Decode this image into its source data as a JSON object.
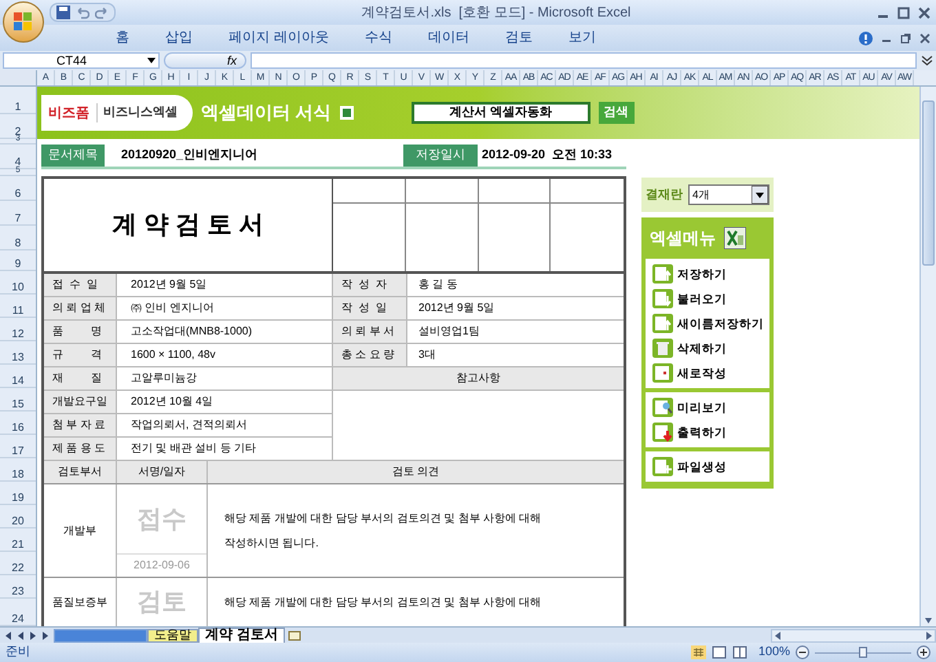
{
  "window": {
    "title": "계약검토서.xls  [호환 모드] - Microsoft Excel"
  },
  "ribbon_tabs": [
    "홈",
    "삽입",
    "페이지 레이아웃",
    "수식",
    "데이터",
    "검토",
    "보기"
  ],
  "formula_bar": {
    "name_box": "CT44",
    "function_label": "fx"
  },
  "column_headers": [
    "A",
    "B",
    "C",
    "D",
    "E",
    "F",
    "G",
    "H",
    "I",
    "J",
    "K",
    "L",
    "M",
    "N",
    "O",
    "P",
    "Q",
    "R",
    "S",
    "T",
    "U",
    "V",
    "W",
    "X",
    "Y",
    "Z",
    "AA",
    "AB",
    "AC",
    "AD",
    "AE",
    "AF",
    "AG",
    "AH",
    "AI",
    "AJ",
    "AK",
    "AL",
    "AM",
    "AN",
    "AO",
    "AP",
    "AQ",
    "AR",
    "AS",
    "AT",
    "AU",
    "AV",
    "AW"
  ],
  "row_headers": [
    "1",
    "2",
    "3",
    "4",
    "5",
    "6",
    "7",
    "8",
    "9",
    "10",
    "11",
    "12",
    "13",
    "14",
    "15",
    "16",
    "17",
    "18",
    "19",
    "20",
    "21",
    "22",
    "23",
    "24"
  ],
  "banner": {
    "brand": "비즈폼",
    "sub_brand": "비즈니스엑셀",
    "title": "엑셀데이터 서식",
    "search_value": "계산서 엑셀자동화",
    "search_button": "검색"
  },
  "document": {
    "title_label": "문서제목",
    "title_value": "20120920_인비엔지니어",
    "saved_label": "저장일시",
    "saved_value": "2012-09-20  오전 10:33"
  },
  "form": {
    "title": "계 약 검 토 서",
    "info_rows": [
      {
        "label": "접  수  일",
        "value": "2012년 9월 5일",
        "right_label": "작  성  자",
        "right_value": "홍 길 동"
      },
      {
        "label": "의 뢰 업 체",
        "value": "㈜ 인비 엔지니어",
        "right_label": "작  성  일",
        "right_value": "2012년 9월 5일"
      },
      {
        "label": "품         명",
        "value": "고소작업대(MNB8-1000)",
        "right_label": "의 뢰 부 서",
        "right_value": "설비영업1팀"
      },
      {
        "label": "규         격",
        "value": "1600 × 1100, 48v",
        "right_label": "총 소 요 량",
        "right_value": "3대"
      },
      {
        "label": "재         질",
        "value": "고알루미늄강",
        "right_header": "참고사항"
      },
      {
        "label": "개발요구일",
        "value": "2012년 10월 4일"
      },
      {
        "label": "첨 부 자 료",
        "value": "작업의뢰서, 견적의뢰서"
      },
      {
        "label": "제 품 용 도",
        "value": "전기 및 배관 설비 등 기타"
      }
    ],
    "review_headers": [
      "검토부서",
      "서명/일자",
      "검토 의견"
    ],
    "reviews": [
      {
        "dept": "개발부",
        "stamp": "접수",
        "date": "2012-09-06",
        "opinion": [
          "해당 제품 개발에 대한 담당 부서의 검토의견 및 첨부 사항에 대해",
          "작성하시면 됩니다."
        ]
      },
      {
        "dept": "품질보증부",
        "stamp": "검토",
        "opinion": [
          "해당 제품 개발에 대한 담당 부서의 검토의견 및 첨부 사항에 대해"
        ]
      }
    ]
  },
  "side_panel": {
    "approval_label": "결재란",
    "approval_value": "4개",
    "menu_title": "엑셀메뉴",
    "menu_groups": [
      [
        {
          "label": "저장하기",
          "kind": "save"
        },
        {
          "label": "불러오기",
          "kind": "load"
        },
        {
          "label": "새이름저장하기",
          "kind": "save"
        },
        {
          "label": "삭제하기",
          "kind": "delete"
        },
        {
          "label": "새로작성",
          "kind": "new"
        }
      ],
      [
        {
          "label": "미리보기",
          "kind": "preview"
        },
        {
          "label": "출력하기",
          "kind": "print"
        }
      ],
      [
        {
          "label": "파일생성",
          "kind": "file"
        }
      ]
    ]
  },
  "sheet_tabs": [
    {
      "label": "도움말",
      "selected": false,
      "color": "#f2ee8c"
    },
    {
      "label": "계약 검토서",
      "selected": true,
      "color": "#ffffff"
    }
  ],
  "status_bar": {
    "status": "준비",
    "zoom": "100%",
    "level": 0.5
  }
}
